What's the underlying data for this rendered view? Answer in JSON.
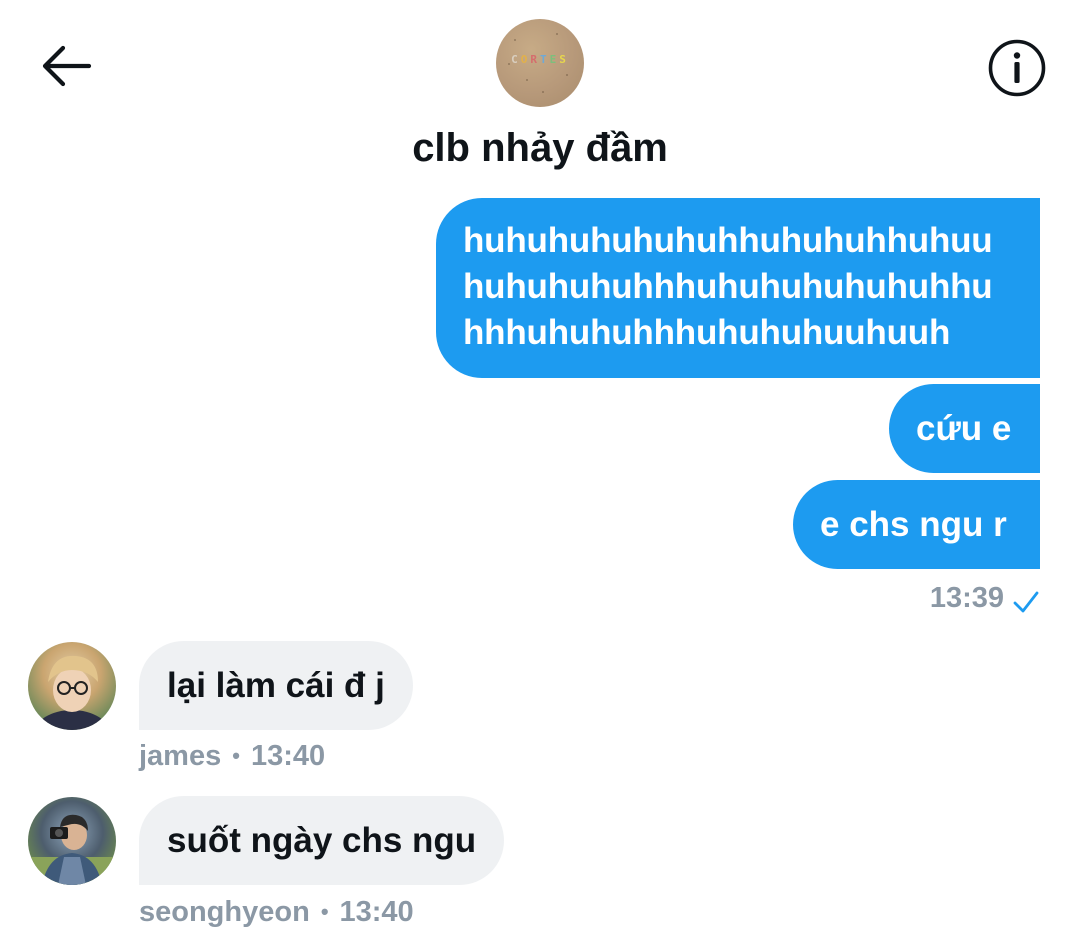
{
  "header": {
    "title": "clb nhảy đầm",
    "avatar_text": "CORTES",
    "back_icon": "arrow-left-icon",
    "info_icon": "info-circle-icon"
  },
  "messages_out": [
    {
      "text": "huhuhuhuhuhuhhuhuhuhhuhuu\nhuhuhuhuhhhuhuhuhuhuhuhhu\nhhhuhuhuhhhuhuhuhuuhuuh"
    },
    {
      "text": "cứu e"
    },
    {
      "text": "e chs ngu r"
    }
  ],
  "sent_meta": {
    "time": "13:39",
    "status_icon": "check-icon"
  },
  "messages_in": [
    {
      "text": "lại làm cái đ j",
      "user": "james",
      "time": "13:40"
    },
    {
      "text": "suốt ngày chs ngu",
      "user": "seonghyeon",
      "time": "13:40"
    }
  ],
  "colors": {
    "outgoing_bubble": "#1d9bf0",
    "incoming_bubble": "#eff1f3",
    "meta_text": "#8b98a5",
    "check": "#1d9bf0"
  }
}
